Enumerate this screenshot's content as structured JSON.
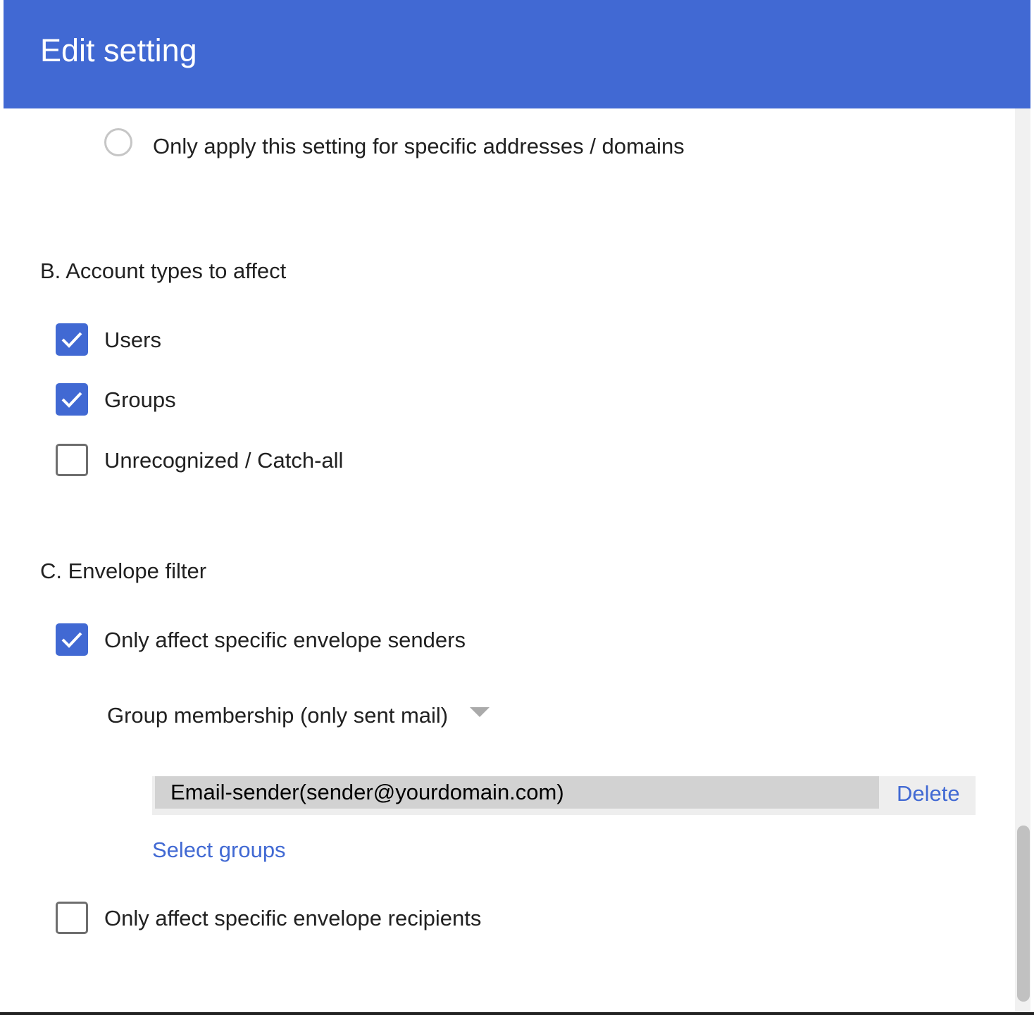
{
  "header": {
    "title": "Edit setting"
  },
  "address_scope": {
    "radio_label": "Only apply this setting for specific addresses / domains",
    "selected": false
  },
  "account_types": {
    "title": "B. Account types to affect",
    "options": [
      {
        "label": "Users",
        "checked": true
      },
      {
        "label": "Groups",
        "checked": true
      },
      {
        "label": "Unrecognized / Catch-all",
        "checked": false
      }
    ]
  },
  "envelope_filter": {
    "title": "C. Envelope filter",
    "senders": {
      "label": "Only affect specific envelope senders",
      "checked": true,
      "dropdown_value": "Group membership (only sent mail)",
      "groups": [
        {
          "label": "Email-sender(sender@yourdomain.com)",
          "delete_label": "Delete"
        }
      ],
      "select_groups_label": "Select groups"
    },
    "recipients": {
      "label": "Only affect specific envelope recipients",
      "checked": false
    }
  },
  "colors": {
    "accent": "#4169d3",
    "text": "#212121",
    "chip_bg": "#d2d2d2"
  }
}
